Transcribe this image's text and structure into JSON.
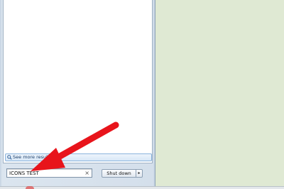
{
  "start_menu": {
    "see_more_label": "See more results",
    "search": {
      "value": "ICONS TEST",
      "clear_glyph": "×"
    },
    "shutdown": {
      "label": "Shut down",
      "arrow_glyph": "▸"
    }
  },
  "annotation": {
    "color": "#e8141b",
    "icon": "red-arrow-icon"
  },
  "colors": {
    "desktop": "#dfe9d3",
    "menu": "#d4dfeb"
  }
}
